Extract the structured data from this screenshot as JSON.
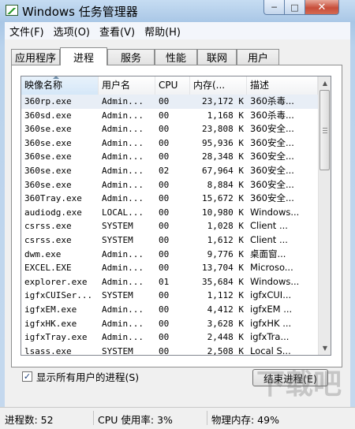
{
  "window": {
    "title": "Windows 任务管理器",
    "min_glyph": "─",
    "max_glyph": "□",
    "close_glyph": "✕"
  },
  "menu": [
    "文件(F)",
    "选项(O)",
    "查看(V)",
    "帮助(H)"
  ],
  "tabs": [
    "应用程序",
    "进程",
    "服务",
    "性能",
    "联网",
    "用户"
  ],
  "active_tab": "进程",
  "columns": {
    "name": "映像名称",
    "user": "用户名",
    "cpu": "CPU",
    "mem": "内存(...",
    "desc": "描述"
  },
  "processes": [
    {
      "name": "360rp.exe",
      "user": "Admin...",
      "cpu": "00",
      "mem": "23,172 K",
      "desc": "360杀毒..."
    },
    {
      "name": "360sd.exe",
      "user": "Admin...",
      "cpu": "00",
      "mem": "1,168 K",
      "desc": "360杀毒..."
    },
    {
      "name": "360se.exe",
      "user": "Admin...",
      "cpu": "00",
      "mem": "23,808 K",
      "desc": "360安全..."
    },
    {
      "name": "360se.exe",
      "user": "Admin...",
      "cpu": "00",
      "mem": "95,936 K",
      "desc": "360安全..."
    },
    {
      "name": "360se.exe",
      "user": "Admin...",
      "cpu": "00",
      "mem": "28,348 K",
      "desc": "360安全..."
    },
    {
      "name": "360se.exe",
      "user": "Admin...",
      "cpu": "02",
      "mem": "67,964 K",
      "desc": "360安全..."
    },
    {
      "name": "360se.exe",
      "user": "Admin...",
      "cpu": "00",
      "mem": "8,884 K",
      "desc": "360安全..."
    },
    {
      "name": "360Tray.exe",
      "user": "Admin...",
      "cpu": "00",
      "mem": "15,672 K",
      "desc": "360安全..."
    },
    {
      "name": "audiodg.exe",
      "user": "LOCAL...",
      "cpu": "00",
      "mem": "10,980 K",
      "desc": "Windows..."
    },
    {
      "name": "csrss.exe",
      "user": "SYSTEM",
      "cpu": "00",
      "mem": "1,028 K",
      "desc": "Client ..."
    },
    {
      "name": "csrss.exe",
      "user": "SYSTEM",
      "cpu": "00",
      "mem": "1,612 K",
      "desc": "Client ..."
    },
    {
      "name": "dwm.exe",
      "user": "Admin...",
      "cpu": "00",
      "mem": "9,776 K",
      "desc": "桌面窗..."
    },
    {
      "name": "EXCEL.EXE",
      "user": "Admin...",
      "cpu": "00",
      "mem": "13,704 K",
      "desc": "Microso..."
    },
    {
      "name": "explorer.exe",
      "user": "Admin...",
      "cpu": "01",
      "mem": "35,684 K",
      "desc": "Windows..."
    },
    {
      "name": "igfxCUISer...",
      "user": "SYSTEM",
      "cpu": "00",
      "mem": "1,112 K",
      "desc": "igfxCUI..."
    },
    {
      "name": "igfxEM.exe",
      "user": "Admin...",
      "cpu": "00",
      "mem": "4,412 K",
      "desc": "igfxEM ..."
    },
    {
      "name": "igfxHK.exe",
      "user": "Admin...",
      "cpu": "00",
      "mem": "3,628 K",
      "desc": "igfxHK ..."
    },
    {
      "name": "igfxTray.exe",
      "user": "Admin...",
      "cpu": "00",
      "mem": "2,448 K",
      "desc": "igfxTra..."
    },
    {
      "name": "lsass.exe",
      "user": "SYSTEM",
      "cpu": "00",
      "mem": "2,508 K",
      "desc": "Local S..."
    }
  ],
  "show_all_users": {
    "checked": true,
    "label": "显示所有用户的进程(S)",
    "check_glyph": "✓"
  },
  "end_process_label": "结束进程(E)",
  "status": {
    "processes": "进程数: 52",
    "cpu": "CPU 使用率: 3%",
    "memory": "物理内存: 49%"
  },
  "watermark": "下载吧"
}
